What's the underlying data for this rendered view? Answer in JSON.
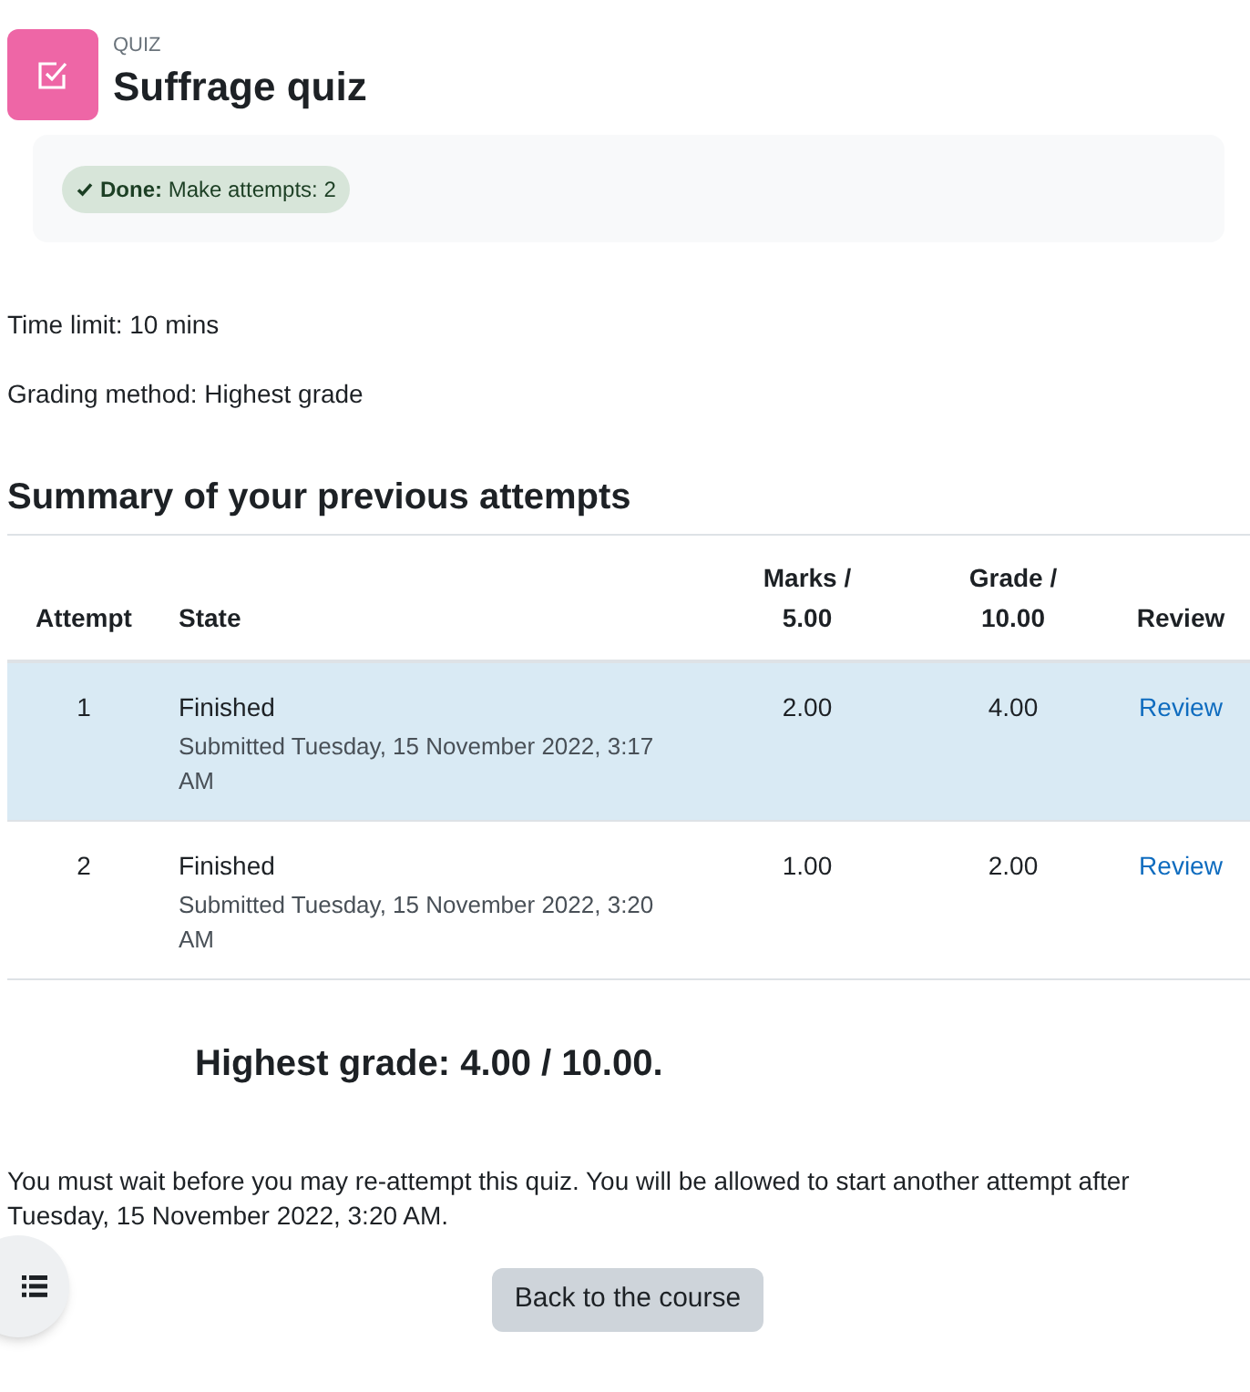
{
  "header": {
    "module_type": "QUIZ",
    "title": "Suffrage quiz"
  },
  "completion": [
    {
      "text": "**Done:** Make attempts: 2",
      "done": true
    }
  ],
  "info": [
    "Time limit: 10 mins",
    "Grading method: Highest grade"
  ],
  "summary": {
    "heading": "Summary of your previous attempts",
    "columns": [
      "Attempt",
      "State",
      "Marks / 5.00",
      "Grade / 10.00",
      "Review"
    ],
    "rows": [
      {
        "attempt": "1",
        "state": "Finished",
        "submitted": "Submitted Tuesday, 15 November 2022, 3:17 AM",
        "marks": "2.00",
        "grade": "4.00",
        "review": "Review",
        "highlighted": true
      },
      {
        "attempt": "2",
        "state": "Finished",
        "submitted": "Submitted Tuesday, 15 November 2022, 3:20 AM",
        "marks": "1.00",
        "grade": "2.00",
        "review": "Review",
        "highlighted": false
      }
    ]
  },
  "result": "Highest grade: 4.00 / 10.00.",
  "message": "You must wait before you may re-attempt this quiz. You will be allowed to start another attempt after Tuesday, 15 November 2022, 3:20 AM.",
  "buttons": [
    "Back to the course"
  ]
}
